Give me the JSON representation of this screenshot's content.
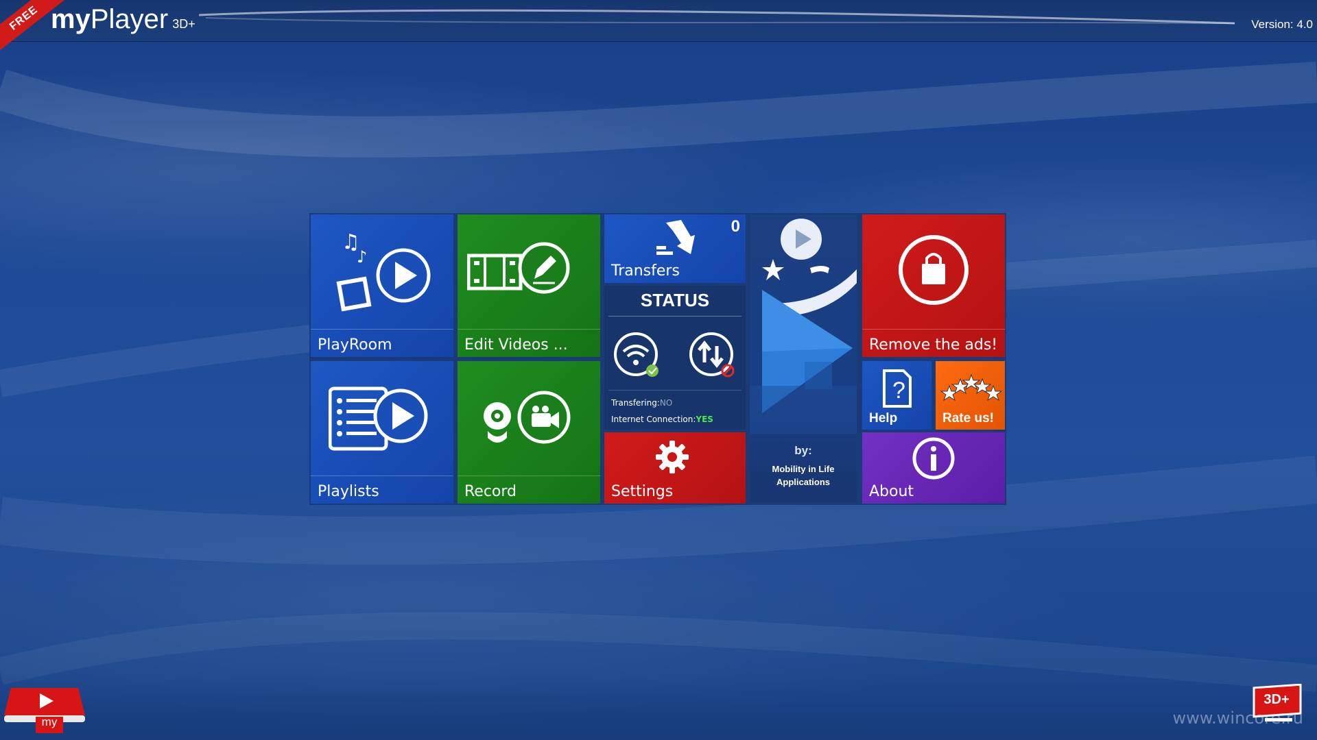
{
  "header": {
    "ribbon": "FREE",
    "logo_my": "my",
    "logo_player": "Player",
    "logo_sub": "3D+",
    "version": "Version: 4.0"
  },
  "tiles": {
    "playroom": "PlayRoom",
    "edit_videos": "Edit Videos ...",
    "transfers": "Transfers",
    "transfers_count": "0",
    "status_title": "STATUS",
    "transfering_label": "Transfering:",
    "transfering_value": "NO",
    "internet_label": "Internet Connection:",
    "internet_value": "YES",
    "settings": "Settings",
    "by": "by:",
    "company_line1": "Mobility in Life",
    "company_line2": "Applications",
    "remove_ads": "Remove the ads!",
    "help": "Help",
    "rate": "Rate us!",
    "playlists": "Playlists",
    "record": "Record",
    "about": "About"
  },
  "footer": {
    "my_logo_label": "my",
    "badge_3d": "3D+",
    "watermark": "www.wincore.ru"
  },
  "colors": {
    "blue_tile": "#1e57c4",
    "green_tile": "#1f8d1f",
    "red_tile": "#d01b1b",
    "purple_tile": "#7330c2",
    "orange_tile": "#ff6a12",
    "status_yes": "#4ee44e"
  },
  "icons": [
    "music-play-icon",
    "film-edit-icon",
    "transfer-hand-icon",
    "wifi-check-icon",
    "sync-blocked-icon",
    "gear-icon",
    "shopping-bag-icon",
    "help-doc-icon",
    "rating-stars-icon",
    "playlist-play-icon",
    "webcam-video-icon",
    "info-icon",
    "play-logo-icon"
  ]
}
